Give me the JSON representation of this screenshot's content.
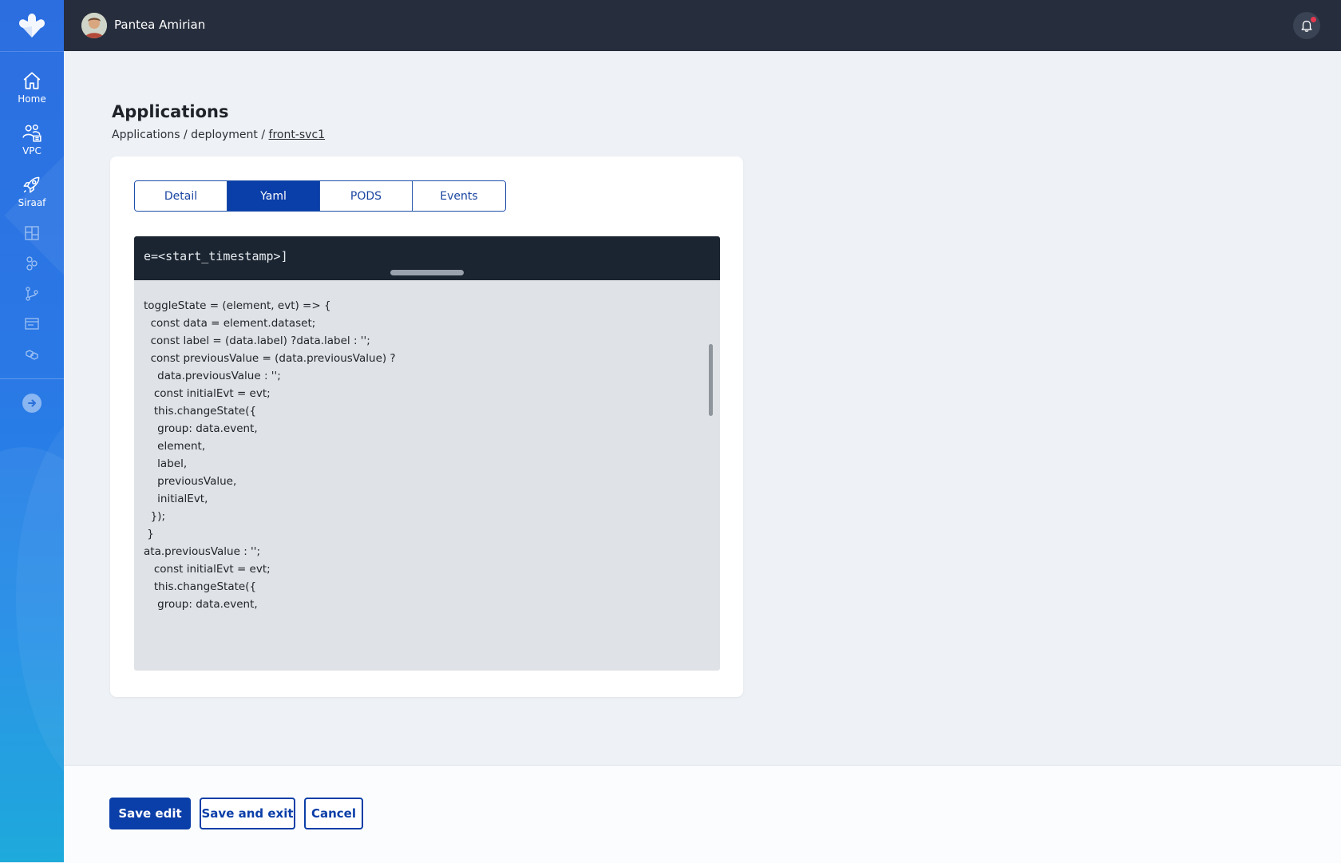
{
  "sidebar": {
    "logo": "logo-icon",
    "items": [
      {
        "label": "Home",
        "icon": "home-icon"
      },
      {
        "label": "VPC",
        "icon": "vpc-icon"
      },
      {
        "label": "Siraaf",
        "icon": "rocket-icon"
      }
    ],
    "small_icons": [
      "dashboard-icon",
      "cluster-icon",
      "git-branch-icon",
      "window-icon",
      "cubes-icon"
    ],
    "expand_icon": "arrow-right-icon"
  },
  "topbar": {
    "username": "Pantea Amirian",
    "notification_icon": "bell-icon",
    "has_unread": true
  },
  "page": {
    "title": "Applications",
    "breadcrumb": {
      "part1": "Applications",
      "sep1": " / ",
      "part2": "deployment",
      "sep2": " / ",
      "current": "front-svc1"
    }
  },
  "tabs": [
    {
      "label": "Detail",
      "active": false
    },
    {
      "label": "Yaml",
      "active": true
    },
    {
      "label": "PODS",
      "active": false
    },
    {
      "label": "Events",
      "active": false
    }
  ],
  "code": {
    "header_text": "e=<start_timestamp>]",
    "lines": "toggleState = (element, evt) => {\n  const data = element.dataset;\n  const label = (data.label) ?data.label : '';\n  const previousValue = (data.previousValue) ?\n    data.previousValue : '';\n   const initialEvt = evt;\n   this.changeState({\n    group: data.event,\n    element,\n    label,\n    previousValue,\n    initialEvt,\n  });\n }\nata.previousValue : '';\n   const initialEvt = evt;\n   this.changeState({\n    group: data.event,"
  },
  "footer": {
    "save_edit": "Save edit",
    "save_and_exit": "Save and exit",
    "cancel": "Cancel"
  },
  "colors": {
    "primary": "#0a3ea8",
    "topbar": "#262e3d",
    "code_header": "#1b2531",
    "code_body": "#dfe2e6",
    "notification_dot": "#e5384f"
  }
}
